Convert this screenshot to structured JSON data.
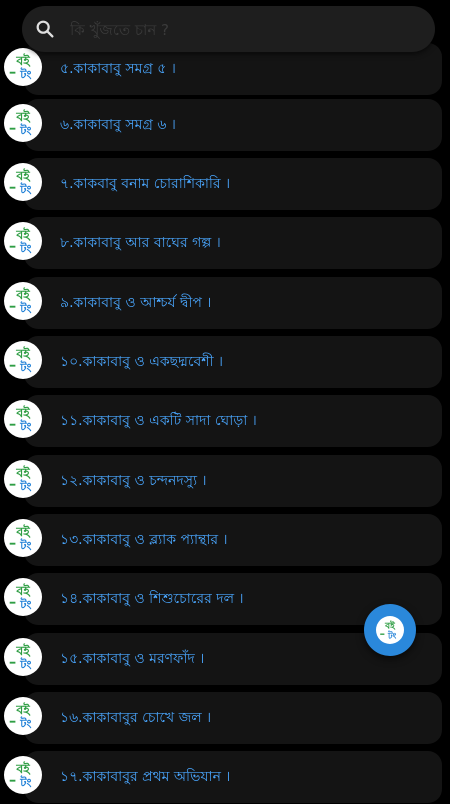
{
  "search": {
    "placeholder": "কি খুঁজতে চান ?"
  },
  "logo": {
    "line1": "বই",
    "line2": "টং"
  },
  "list": {
    "items": [
      {
        "label": "৫.কাকাবাবু সমগ্র ৫ ।"
      },
      {
        "label": "৬.কাকাবাবু সমগ্র ৬ ।"
      },
      {
        "label": "৭.কাকবাবু বনাম চোরাশিকারি ।"
      },
      {
        "label": "৮.কাকাবাবু আর বাঘের গল্প ।"
      },
      {
        "label": "৯.কাকাবাবু ও আশ্চর্য দ্বীপ ।"
      },
      {
        "label": "১০.কাকাবাবু ও একছদ্মবেশী ।"
      },
      {
        "label": "১১.কাকাবাবু ও একটি সাদা ঘোড়া ।"
      },
      {
        "label": "১২.কাকাবাবু ও চন্দনদস্যু ।"
      },
      {
        "label": "১৩.কাকাবাবু ও ব্ল্যাক প্যান্থার ।"
      },
      {
        "label": "১৪.কাকাবাবু ও শিশুচোরের দল ।"
      },
      {
        "label": "১৫.কাকাবাবু ও মরণফাঁদ ।"
      },
      {
        "label": "১৬.কাকাবাবুর চোখে জল ।"
      },
      {
        "label": "১৭.কাকাবাবুর প্রথম অভিযান ।"
      }
    ]
  },
  "colors": {
    "accent": "#2a88db",
    "label": "#4aa7ff",
    "logo_green": "#2f9e44",
    "logo_blue": "#1c7ed6"
  }
}
